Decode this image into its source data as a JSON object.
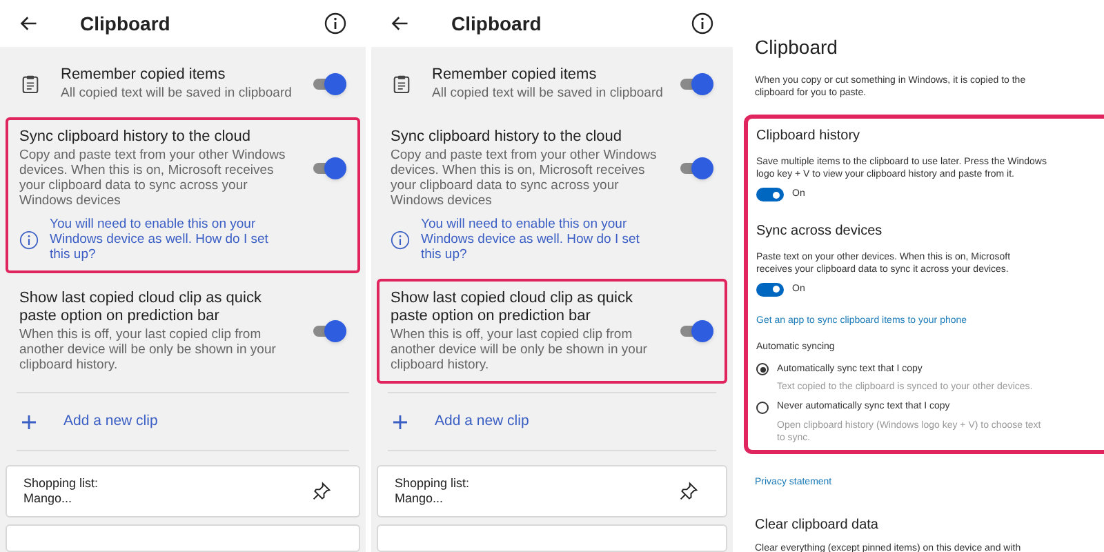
{
  "phone_panels": [
    {
      "header": {
        "title": "Clipboard"
      },
      "settings": [
        {
          "kind": "with_icon",
          "title": "Remember copied items",
          "description": "All copied text will be saved in clipboard",
          "on": true,
          "highlighted": false
        },
        {
          "kind": "plain",
          "title": "Sync clipboard history to the cloud",
          "description": "Copy and paste text from your other Windows devices. When this is on, Microsoft receives your clipboard data to sync across your Windows devices",
          "on": true,
          "highlighted": true,
          "note": "You will need to enable this on your Windows device as well. How do I set this up?"
        },
        {
          "kind": "plain",
          "title": "Show last copied cloud clip as quick paste option on prediction bar",
          "description": "When this is off, your last copied clip from another device will be only be shown in your clipboard history.",
          "on": true,
          "highlighted": false
        }
      ],
      "add_clip": {
        "label": "Add a new clip"
      },
      "clips": [
        {
          "text": "Shopping list:\nMango..."
        }
      ]
    },
    {
      "header": {
        "title": "Clipboard"
      },
      "settings": [
        {
          "kind": "with_icon",
          "title": "Remember copied items",
          "description": "All copied text will be saved in clipboard",
          "on": true,
          "highlighted": false
        },
        {
          "kind": "plain",
          "title": "Sync clipboard history to the cloud",
          "description": "Copy and paste text from your other Windows devices. When this is on, Microsoft receives your clipboard data to sync across your Windows devices",
          "on": true,
          "highlighted": false,
          "note": "You will need to enable this on your Windows device as well. How do I set this up?"
        },
        {
          "kind": "plain",
          "title": "Show last copied cloud clip as quick paste option on prediction bar",
          "description": "When this is off, your last copied clip from another device will be only be shown in your clipboard history.",
          "on": true,
          "highlighted": true
        }
      ],
      "add_clip": {
        "label": "Add a new clip"
      },
      "clips": [
        {
          "text": "Shopping list:\nMango..."
        }
      ]
    }
  ],
  "windows_panel": {
    "title": "Clipboard",
    "intro": "When you copy or cut something in Windows, it is copied to the clipboard for you to paste.",
    "highlighted_section": {
      "clipboard_history": {
        "heading": "Clipboard history",
        "description": "Save multiple items to the clipboard to use later. Press the Windows logo key + V to view your clipboard history and paste from it.",
        "on": true,
        "state_label": "On"
      },
      "sync": {
        "heading": "Sync across devices",
        "description": "Paste text on your other devices. When this is on, Microsoft receives your clipboard data to sync it across your devices.",
        "on": true,
        "state_label": "On",
        "link": "Get an app to sync clipboard items to your phone",
        "group_label": "Automatic syncing",
        "options": [
          {
            "label": "Automatically sync text that I copy",
            "hint": "Text copied to the clipboard is synced to your other devices.",
            "selected": true
          },
          {
            "label": "Never automatically sync text that I copy",
            "hint": "Open clipboard history (Windows logo key + V) to choose text to sync.",
            "selected": false
          }
        ]
      }
    },
    "privacy_link": "Privacy statement",
    "clear": {
      "heading": "Clear clipboard data",
      "description": "Clear everything (except pinned items) on this device and with"
    }
  }
}
